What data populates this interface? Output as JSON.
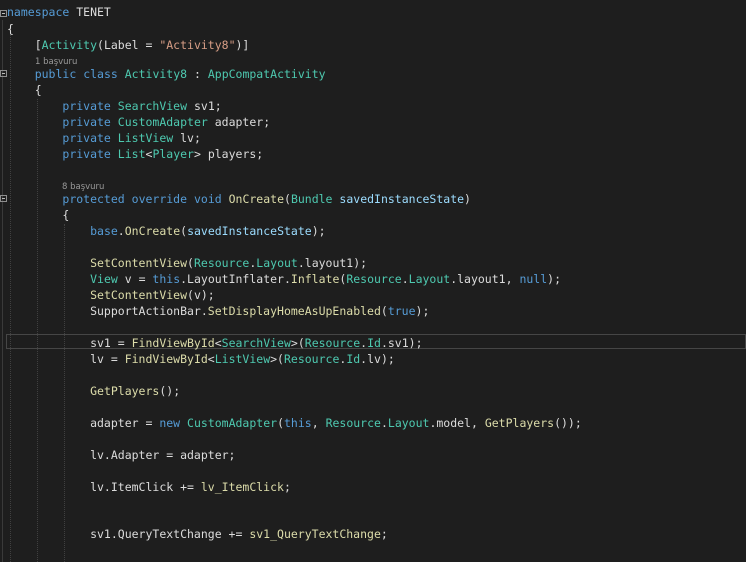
{
  "theme": {
    "background": "#1e1e1e",
    "keyword": "#569cd6",
    "type": "#4ec9b0",
    "method": "#dcdcaa",
    "string": "#d69d85",
    "parameter": "#9cdcfe",
    "text": "#dcdcdc",
    "codelens": "#999999"
  },
  "codelens": {
    "class_refs": "1 başvuru",
    "method_refs": "8 başvuru"
  },
  "lines": [
    {
      "id": "namespace-decl",
      "tokens": [
        [
          "k",
          "namespace"
        ],
        [
          "d",
          " TENET"
        ]
      ]
    },
    {
      "id": "namespace-open",
      "tokens": [
        [
          "d",
          "{"
        ]
      ]
    },
    {
      "id": "attribute",
      "tokens": [
        [
          "d",
          "    ["
        ],
        [
          "t",
          "Activity"
        ],
        [
          "d",
          "(Label = "
        ],
        [
          "s",
          "\"Activity8\""
        ],
        [
          "d",
          ")]"
        ]
      ]
    },
    {
      "id": "class-decl",
      "tokens": [
        [
          "d",
          "    "
        ],
        [
          "k",
          "public"
        ],
        [
          "d",
          " "
        ],
        [
          "k",
          "class"
        ],
        [
          "d",
          " "
        ],
        [
          "t",
          "Activity8"
        ],
        [
          "d",
          " : "
        ],
        [
          "t",
          "AppCompatActivity"
        ]
      ]
    },
    {
      "id": "class-open",
      "tokens": [
        [
          "d",
          "    {"
        ]
      ]
    },
    {
      "id": "field-sv1",
      "tokens": [
        [
          "d",
          "        "
        ],
        [
          "k",
          "private"
        ],
        [
          "d",
          " "
        ],
        [
          "t",
          "SearchView"
        ],
        [
          "d",
          " sv1;"
        ]
      ]
    },
    {
      "id": "field-adapter",
      "tokens": [
        [
          "d",
          "        "
        ],
        [
          "k",
          "private"
        ],
        [
          "d",
          " "
        ],
        [
          "t",
          "CustomAdapter"
        ],
        [
          "d",
          " adapter;"
        ]
      ]
    },
    {
      "id": "field-lv",
      "tokens": [
        [
          "d",
          "        "
        ],
        [
          "k",
          "private"
        ],
        [
          "d",
          " "
        ],
        [
          "t",
          "ListView"
        ],
        [
          "d",
          " lv;"
        ]
      ]
    },
    {
      "id": "field-players",
      "tokens": [
        [
          "d",
          "        "
        ],
        [
          "k",
          "private"
        ],
        [
          "d",
          " "
        ],
        [
          "t",
          "List"
        ],
        [
          "d",
          "<"
        ],
        [
          "t",
          "Player"
        ],
        [
          "d",
          "> players;"
        ]
      ]
    },
    {
      "id": "method-decl",
      "tokens": [
        [
          "d",
          "        "
        ],
        [
          "k",
          "protected"
        ],
        [
          "d",
          " "
        ],
        [
          "k",
          "override"
        ],
        [
          "d",
          " "
        ],
        [
          "k",
          "void"
        ],
        [
          "d",
          " "
        ],
        [
          "m",
          "OnCreate"
        ],
        [
          "d",
          "("
        ],
        [
          "t",
          "Bundle"
        ],
        [
          "d",
          " "
        ],
        [
          "p",
          "savedInstanceState"
        ],
        [
          "d",
          ")"
        ]
      ]
    },
    {
      "id": "method-open",
      "tokens": [
        [
          "d",
          "        {"
        ]
      ]
    },
    {
      "id": "base-oncreate",
      "tokens": [
        [
          "d",
          "            "
        ],
        [
          "k",
          "base"
        ],
        [
          "d",
          "."
        ],
        [
          "m",
          "OnCreate"
        ],
        [
          "d",
          "("
        ],
        [
          "p",
          "savedInstanceState"
        ],
        [
          "d",
          ");"
        ]
      ]
    },
    {
      "id": "setcontentview-1",
      "tokens": [
        [
          "d",
          "            "
        ],
        [
          "m",
          "SetContentView"
        ],
        [
          "d",
          "("
        ],
        [
          "t",
          "Resource"
        ],
        [
          "d",
          "."
        ],
        [
          "t",
          "Layout"
        ],
        [
          "d",
          ".layout1);"
        ]
      ]
    },
    {
      "id": "view-inflate",
      "tokens": [
        [
          "d",
          "            "
        ],
        [
          "t",
          "View"
        ],
        [
          "d",
          " v = "
        ],
        [
          "k",
          "this"
        ],
        [
          "d",
          ".LayoutInflater."
        ],
        [
          "m",
          "Inflate"
        ],
        [
          "d",
          "("
        ],
        [
          "t",
          "Resource"
        ],
        [
          "d",
          "."
        ],
        [
          "t",
          "Layout"
        ],
        [
          "d",
          ".layout1, "
        ],
        [
          "k",
          "null"
        ],
        [
          "d",
          ");"
        ]
      ]
    },
    {
      "id": "setcontentview-2",
      "tokens": [
        [
          "d",
          "            "
        ],
        [
          "m",
          "SetContentView"
        ],
        [
          "d",
          "(v);"
        ]
      ]
    },
    {
      "id": "actionbar",
      "tokens": [
        [
          "d",
          "            SupportActionBar."
        ],
        [
          "m",
          "SetDisplayHomeAsUpEnabled"
        ],
        [
          "d",
          "("
        ],
        [
          "k",
          "true"
        ],
        [
          "d",
          ");"
        ]
      ]
    },
    {
      "id": "find-sv1",
      "tokens": [
        [
          "d",
          "            sv1 = "
        ],
        [
          "m",
          "FindViewById"
        ],
        [
          "d",
          "<"
        ],
        [
          "t",
          "SearchView"
        ],
        [
          "d",
          ">("
        ],
        [
          "t",
          "Resource"
        ],
        [
          "d",
          "."
        ],
        [
          "t",
          "Id"
        ],
        [
          "d",
          ".sv1);"
        ]
      ]
    },
    {
      "id": "find-lv",
      "tokens": [
        [
          "d",
          "            lv = "
        ],
        [
          "m",
          "FindViewById"
        ],
        [
          "d",
          "<"
        ],
        [
          "t",
          "ListView"
        ],
        [
          "d",
          ">("
        ],
        [
          "t",
          "Resource"
        ],
        [
          "d",
          "."
        ],
        [
          "t",
          "Id"
        ],
        [
          "d",
          ".lv);"
        ]
      ]
    },
    {
      "id": "getplayers",
      "tokens": [
        [
          "d",
          "            "
        ],
        [
          "m",
          "GetPlayers"
        ],
        [
          "d",
          "();"
        ]
      ]
    },
    {
      "id": "new-adapter",
      "tokens": [
        [
          "d",
          "            adapter = "
        ],
        [
          "k",
          "new"
        ],
        [
          "d",
          " "
        ],
        [
          "t",
          "CustomAdapter"
        ],
        [
          "d",
          "("
        ],
        [
          "k",
          "this"
        ],
        [
          "d",
          ", "
        ],
        [
          "t",
          "Resource"
        ],
        [
          "d",
          "."
        ],
        [
          "t",
          "Layout"
        ],
        [
          "d",
          ".model, "
        ],
        [
          "m",
          "GetPlayers"
        ],
        [
          "d",
          "());"
        ]
      ]
    },
    {
      "id": "lv-adapter",
      "tokens": [
        [
          "d",
          "            lv.Adapter = adapter;"
        ]
      ]
    },
    {
      "id": "lv-itemclick",
      "tokens": [
        [
          "d",
          "            lv.ItemClick += "
        ],
        [
          "m",
          "lv_ItemClick"
        ],
        [
          "d",
          ";"
        ]
      ]
    },
    {
      "id": "sv1-querytext",
      "tokens": [
        [
          "d",
          "            sv1.QueryTextChange += "
        ],
        [
          "m",
          "sv1_QueryTextChange"
        ],
        [
          "d",
          ";"
        ]
      ]
    }
  ]
}
